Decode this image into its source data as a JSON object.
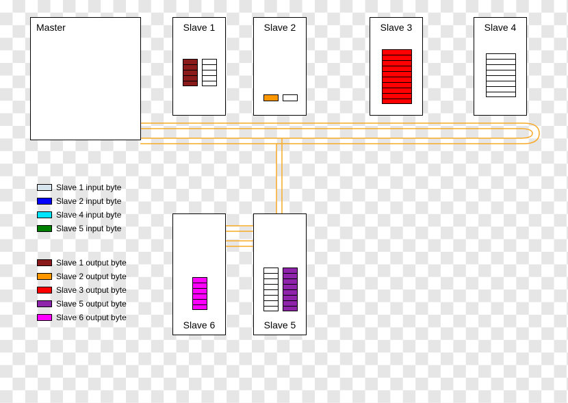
{
  "master": {
    "title": "Master"
  },
  "slaves": {
    "s1": {
      "title": "Slave 1"
    },
    "s2": {
      "title": "Slave 2"
    },
    "s3": {
      "title": "Slave 3"
    },
    "s4": {
      "title": "Slave 4"
    },
    "s5": {
      "title": "Slave 5"
    },
    "s6": {
      "title": "Slave 6"
    }
  },
  "colors": {
    "s1_input": "#d6e4ee",
    "s2_input": "#0000ff",
    "s4_input": "#00e5ff",
    "s5_input": "#008000",
    "s1_output": "#8b1a1a",
    "s2_output": "#ff9800",
    "s3_output": "#ff0000",
    "s5_output": "#8e24aa",
    "s6_output": "#ff00ff",
    "white": "#ffffff"
  },
  "byte_blocks": {
    "s1_out": {
      "rows": 5,
      "color_key": "s1_output"
    },
    "s1_in": {
      "rows": 5,
      "color_key": "white"
    },
    "s3_out": {
      "rows": 10,
      "color_key": "s3_output"
    },
    "s4_in": {
      "rows": 8,
      "color_key": "white"
    },
    "s5_in": {
      "rows": 8,
      "color_key": "white"
    },
    "s5_out": {
      "rows": 8,
      "color_key": "s5_output"
    },
    "s6_out": {
      "rows": 6,
      "color_key": "s6_output"
    }
  },
  "legend_input": [
    {
      "color_key": "s1_input",
      "label": "Slave 1 input byte"
    },
    {
      "color_key": "s2_input",
      "label": "Slave 2 input byte"
    },
    {
      "color_key": "s4_input",
      "label": "Slave 4 input byte"
    },
    {
      "color_key": "s5_input",
      "label": "Slave 5 input byte"
    }
  ],
  "legend_output": [
    {
      "color_key": "s1_output",
      "label": "Slave 1 output byte"
    },
    {
      "color_key": "s2_output",
      "label": "Slave 2 output byte"
    },
    {
      "color_key": "s3_output",
      "label": "Slave 3 output byte"
    },
    {
      "color_key": "s5_output",
      "label": "Slave 5 output byte"
    },
    {
      "color_key": "s6_output",
      "label": "Slave 6 output byte"
    }
  ]
}
